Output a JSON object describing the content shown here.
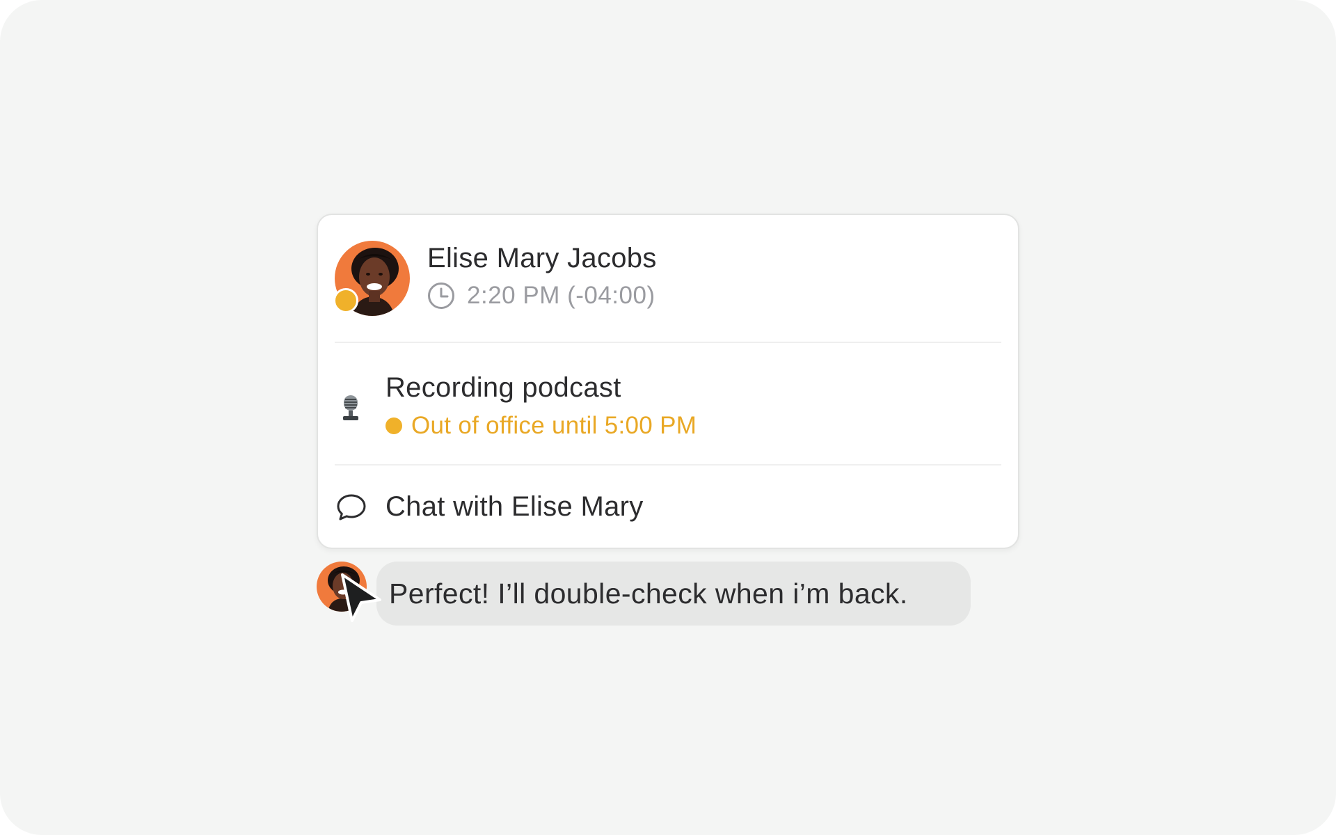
{
  "profile": {
    "name": "Elise Mary Jacobs",
    "local_time": "2:20 PM (-04:00)",
    "presence_color": "#f0b12a",
    "avatar_bg": "#f07a3c"
  },
  "status": {
    "emoji": "studio-microphone-icon",
    "title": "Recording podcast",
    "availability": "Out of office until 5:00 PM",
    "availability_color": "#e9a825"
  },
  "actions": {
    "chat_label": "Chat with Elise Mary"
  },
  "message": {
    "text": "Perfect! I’ll double-check when i’m back."
  }
}
